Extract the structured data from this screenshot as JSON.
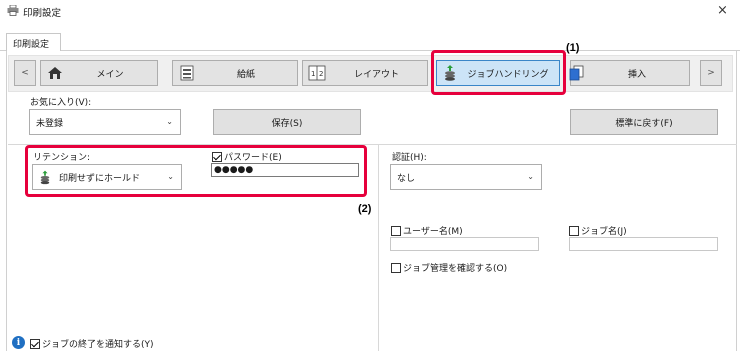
{
  "window": {
    "title": "印刷設定",
    "close": "×"
  },
  "tabs": [
    {
      "label": "印刷設定"
    }
  ],
  "nav": {
    "prev": "<",
    "next": ">",
    "items": [
      {
        "label": "メイン"
      },
      {
        "label": "給紙"
      },
      {
        "label": "レイアウト"
      },
      {
        "label": "ジョブハンドリング",
        "active": true
      },
      {
        "label": "挿入"
      }
    ]
  },
  "favorites": {
    "label": "お気に入り(V):",
    "value": "未登録",
    "save": "保存(S)",
    "reset": "標準に戻す(F)"
  },
  "retention": {
    "label": "リテンション:",
    "value": "印刷せずにホールド"
  },
  "password": {
    "label": "パスワード(E)",
    "checked": true,
    "value": "●●●●●"
  },
  "auth": {
    "label": "認証(H):",
    "value": "なし"
  },
  "user_name": {
    "label": "ユーザー名(M)",
    "checked": false
  },
  "job_name": {
    "label": "ジョブ名(J)",
    "checked": false
  },
  "confirm_job": {
    "label": "ジョブ管理を確認する(O)",
    "checked": false
  },
  "notify": {
    "label": "ジョブの終了を通知する(Y)",
    "checked": true
  },
  "callouts": {
    "one": "(1)",
    "two": "(2)"
  },
  "colors": {
    "highlight": "#e6003c",
    "active_tab": "#cce4f7",
    "info": "#1f6fc2"
  }
}
